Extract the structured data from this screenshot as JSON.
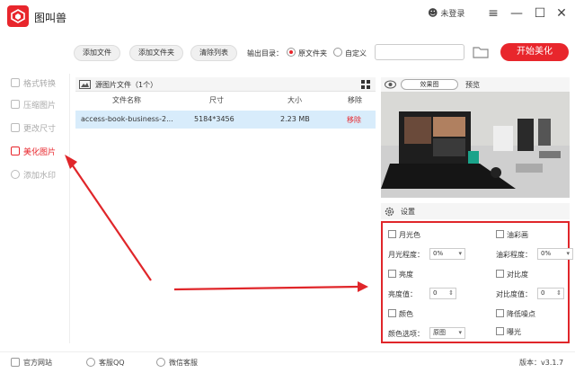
{
  "app": {
    "name": "图叫兽",
    "user_label": "未登录",
    "brand_color": "#e8262c"
  },
  "toolbar": {
    "add_file": "添加文件",
    "add_folder": "添加文件夹",
    "clear_list": "清除列表",
    "output_label": "输出目录：",
    "option_source": "原文件夹",
    "option_custom": "自定义",
    "output_path_value": "",
    "start_button": "开始美化"
  },
  "sidebar": {
    "items": [
      {
        "label": "格式转换",
        "active": false
      },
      {
        "label": "压缩图片",
        "active": false
      },
      {
        "label": "更改尺寸",
        "active": false
      },
      {
        "label": "美化图片",
        "active": true
      },
      {
        "label": "添加水印",
        "active": false
      }
    ]
  },
  "filelist": {
    "header": "源图片文件（1个）",
    "columns": [
      "文件名称",
      "尺寸",
      "大小",
      "移除"
    ],
    "rows": [
      {
        "name": "access-book-business-2...",
        "size": "5184*3456",
        "filesize": "2.23 MB",
        "remove": "移除"
      }
    ]
  },
  "preview": {
    "effect_select": "效果图",
    "label": "预览"
  },
  "settings": {
    "title": "设置",
    "moonlight": "月光色",
    "oil": "油彩画",
    "moon_level_label": "月光程度：",
    "moon_level": "0%",
    "oil_level_label": "油彩程度：",
    "oil_level": "0%",
    "brightness": "亮度",
    "contrast": "对比度",
    "brightness_value_label": "亮度值：",
    "brightness_value": "0",
    "contrast_value_label": "对比度值：",
    "contrast_value": "0",
    "color": "颜色",
    "denoise": "降低噪点",
    "color_option_label": "颜色选项：",
    "color_option": "原图",
    "exposure": "曝光"
  },
  "footer": {
    "website": "官方网站",
    "qq": "客服QQ",
    "wechat": "微信客服",
    "version": "版本：v3.1.7"
  }
}
